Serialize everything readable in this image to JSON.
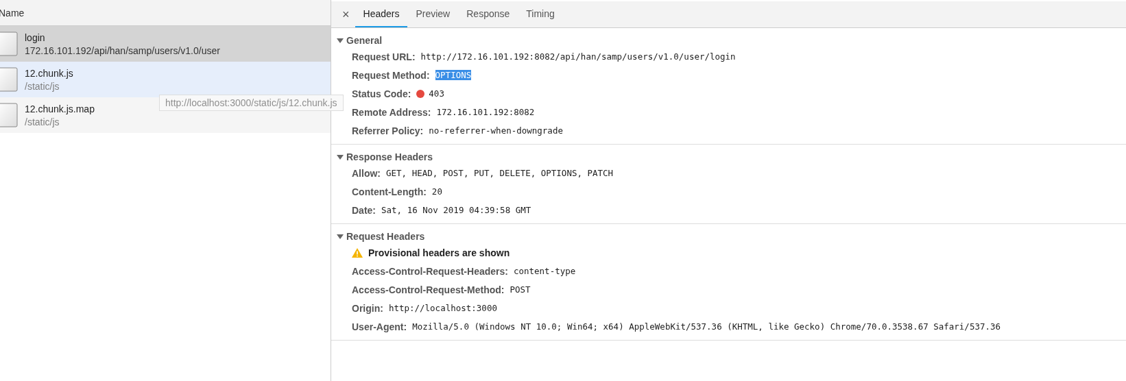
{
  "request_list": {
    "column_header": "Name",
    "rows": [
      {
        "name": "login",
        "path": "172.16.101.192/api/han/samp/users/v1.0/user",
        "selected": true,
        "hovered": false
      },
      {
        "name": "12.chunk.js",
        "path": "/static/js",
        "selected": false,
        "hovered": true
      },
      {
        "name": "12.chunk.js.map",
        "path": "/static/js",
        "selected": false,
        "hovered": false
      }
    ]
  },
  "tooltip": "http://localhost:3000/static/js/12.chunk.js",
  "details": {
    "close": "×",
    "tabs": [
      {
        "label": "Headers",
        "selected": true
      },
      {
        "label": "Preview",
        "selected": false
      },
      {
        "label": "Response",
        "selected": false
      },
      {
        "label": "Timing",
        "selected": false
      }
    ],
    "sections": [
      {
        "title": "General",
        "expanded": true,
        "rows": [
          {
            "kind": "field",
            "name": "Request URL:",
            "value": "http://172.16.101.192:8082/api/han/samp/users/v1.0/user/login",
            "highlighted": false
          },
          {
            "kind": "field",
            "name": "Request Method:",
            "value": "OPTIONS",
            "highlighted": true
          },
          {
            "kind": "status",
            "name": "Status Code:",
            "value": "403",
            "color": "#e5493f",
            "highlighted": false
          },
          {
            "kind": "field",
            "name": "Remote Address:",
            "value": "172.16.101.192:8082",
            "highlighted": false
          },
          {
            "kind": "field",
            "name": "Referrer Policy:",
            "value": "no-referrer-when-downgrade",
            "highlighted": false
          }
        ]
      },
      {
        "title": "Response Headers",
        "expanded": true,
        "rows": [
          {
            "kind": "field",
            "name": "Allow:",
            "value": "GET, HEAD, POST, PUT, DELETE, OPTIONS, PATCH",
            "highlighted": false
          },
          {
            "kind": "field",
            "name": "Content-Length:",
            "value": "20",
            "highlighted": false
          },
          {
            "kind": "field",
            "name": "Date:",
            "value": "Sat, 16 Nov 2019 04:39:58 GMT",
            "highlighted": false
          }
        ]
      },
      {
        "title": "Request Headers",
        "expanded": true,
        "rows": [
          {
            "kind": "warning",
            "name": "Provisional headers are shown"
          },
          {
            "kind": "field",
            "name": "Access-Control-Request-Headers:",
            "value": "content-type",
            "highlighted": false
          },
          {
            "kind": "field",
            "name": "Access-Control-Request-Method:",
            "value": "POST",
            "highlighted": false
          },
          {
            "kind": "field",
            "name": "Origin:",
            "value": "http://localhost:3000",
            "highlighted": false
          },
          {
            "kind": "field",
            "name": "User-Agent:",
            "value": "Mozilla/5.0 (Windows NT 10.0; Win64; x64) AppleWebKit/537.36 (KHTML, like Gecko) Chrome/70.0.3538.67 Safari/537.36",
            "highlighted": false
          }
        ]
      }
    ]
  }
}
